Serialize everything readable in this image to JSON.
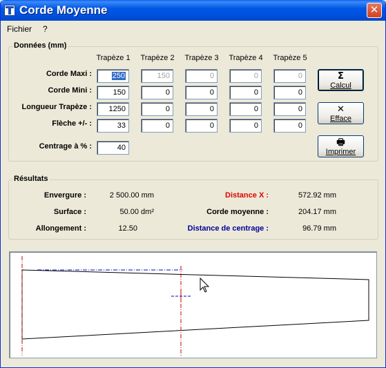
{
  "window": {
    "title": "Corde Moyenne",
    "close_glyph": "✕"
  },
  "menu": {
    "file": "Fichier",
    "help": "?"
  },
  "donnees": {
    "group_label": "Données (mm)",
    "columns": [
      "Trapèze 1",
      "Trapèze 2",
      "Trapèze 3",
      "Trapèze 4",
      "Trapèze 5"
    ],
    "rows": [
      {
        "label": "Corde Maxi :",
        "values": [
          "250",
          "150",
          "0",
          "0",
          "0"
        ]
      },
      {
        "label": "Corde Mini :",
        "values": [
          "150",
          "0",
          "0",
          "0",
          "0"
        ]
      },
      {
        "label": "Longueur Trapèze :",
        "values": [
          "1250",
          "0",
          "0",
          "0",
          "0"
        ]
      },
      {
        "label": "Flèche  +/- :",
        "values": [
          "33",
          "0",
          "0",
          "0",
          "0"
        ]
      }
    ],
    "centrage_label": "Centrage à  % :",
    "centrage_value": "40"
  },
  "buttons": {
    "calcul": {
      "glyph": "Σ",
      "label": "Calcul"
    },
    "efface": {
      "glyph": "✕",
      "label": "Efface"
    },
    "imprimer": {
      "glyph": "🖶",
      "label": "Imprimer"
    }
  },
  "resultats": {
    "group_label": "Résultats",
    "envergure_label": "Envergure :",
    "envergure_value": "2 500.00 mm",
    "surface_label": "Surface :",
    "surface_value": "50.00 dm²",
    "allongement_label": "Allongement :",
    "allongement_value": "12.50",
    "distance_x_label": "Distance X :",
    "distance_x_value": "572.92 mm",
    "corde_moyenne_label": "Corde moyenne :",
    "corde_moyenne_value": "204.17 mm",
    "distance_centrage_label": "Distance de centrage :",
    "distance_centrage_value": "96.79 mm"
  },
  "colors": {
    "distance_x": "#e00000",
    "distance_centrage": "#00009c",
    "axis_red": "#cc0000",
    "axis_blue": "#0000c0"
  }
}
